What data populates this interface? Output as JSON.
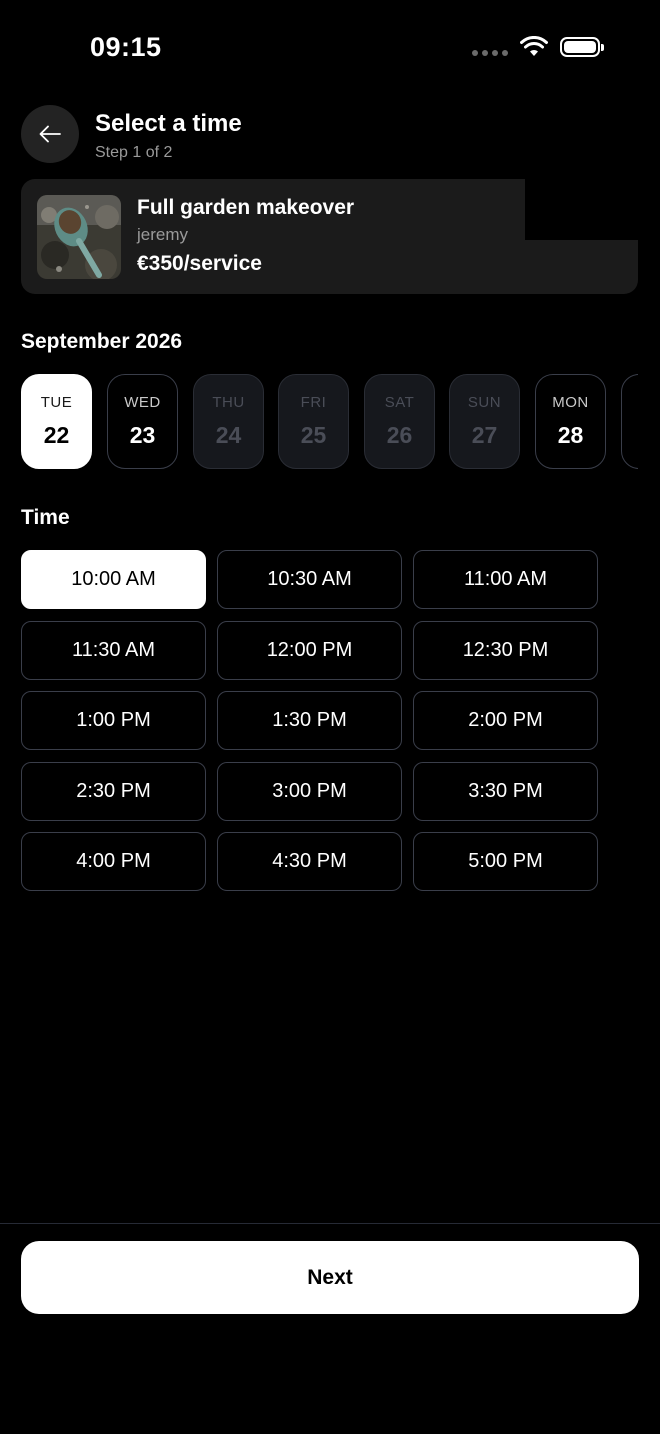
{
  "status_bar": {
    "time": "09:15"
  },
  "header": {
    "title": "Select a time",
    "subtitle": "Step 1 of 2"
  },
  "service": {
    "title": "Full garden makeover",
    "provider": "jeremy",
    "price": "€350/service"
  },
  "calendar": {
    "month_label": "September 2026",
    "days": [
      {
        "dow": "TUE",
        "num": "22",
        "state": "selected"
      },
      {
        "dow": "WED",
        "num": "23",
        "state": "available"
      },
      {
        "dow": "THU",
        "num": "24",
        "state": "disabled"
      },
      {
        "dow": "FRI",
        "num": "25",
        "state": "disabled"
      },
      {
        "dow": "SAT",
        "num": "26",
        "state": "disabled"
      },
      {
        "dow": "SUN",
        "num": "27",
        "state": "disabled"
      },
      {
        "dow": "MON",
        "num": "28",
        "state": "available"
      },
      {
        "dow": "",
        "num": "",
        "state": "available"
      }
    ]
  },
  "time": {
    "label": "Time",
    "selected": "10:00 AM",
    "slots": [
      "10:00 AM",
      "10:30 AM",
      "11:00 AM",
      "11:30 AM",
      "12:00 PM",
      "12:30 PM",
      "1:00 PM",
      "1:30 PM",
      "2:00 PM",
      "2:30 PM",
      "3:00 PM",
      "3:30 PM",
      "4:00 PM",
      "4:30 PM",
      "5:00 PM"
    ]
  },
  "footer": {
    "next_label": "Next"
  }
}
